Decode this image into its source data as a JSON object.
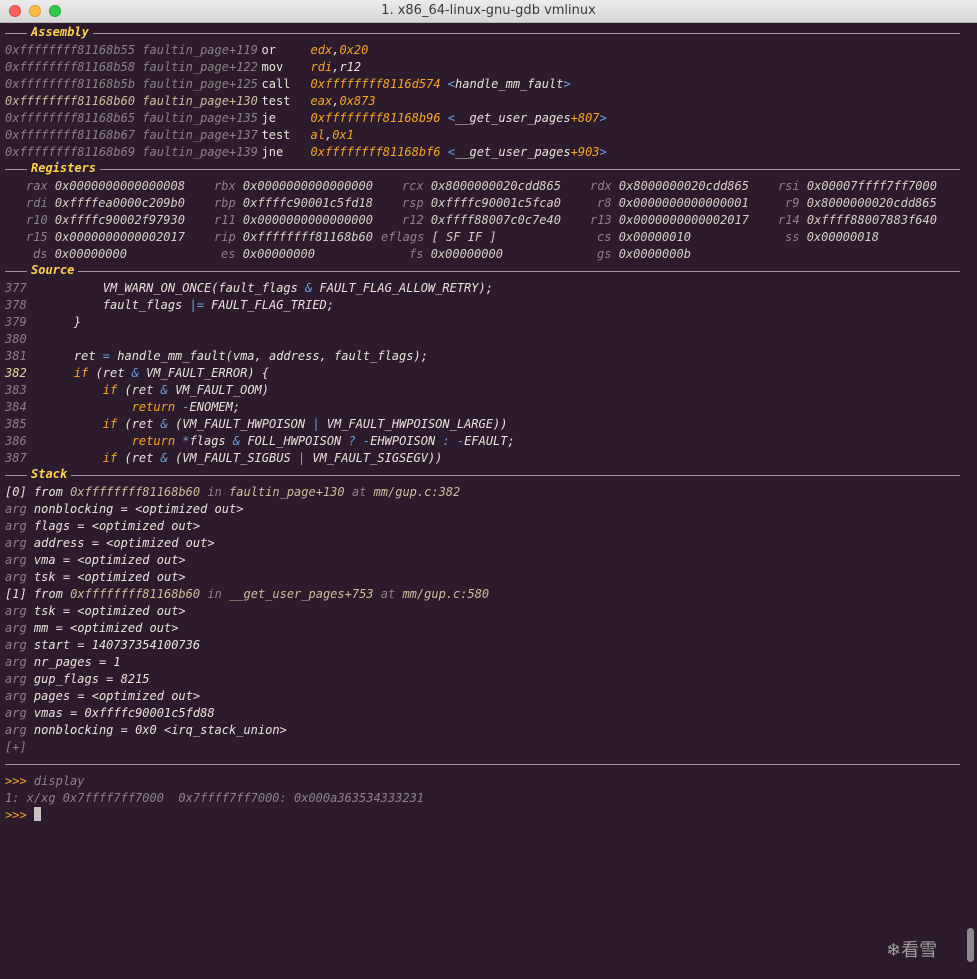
{
  "window": {
    "title": "1. x86_64-linux-gnu-gdb vmlinux"
  },
  "sections": {
    "assembly": "Assembly",
    "registers": "Registers",
    "source": "Source",
    "stack": "Stack"
  },
  "assembly": [
    {
      "addr": "0xffffffff81168b55",
      "sym": "faultin_page+119",
      "mnem": "or",
      "op1": "edx",
      "comma": ",",
      "op2": "0x20",
      "current": false
    },
    {
      "addr": "0xffffffff81168b58",
      "sym": "faultin_page+122",
      "mnem": "mov",
      "op1": "rdi",
      "comma": ",",
      "op2": "r12",
      "current": false
    },
    {
      "addr": "0xffffffff81168b5b",
      "sym": "faultin_page+125",
      "mnem": "call",
      "op1": "0xffffffff8116d574",
      "target": "handle_mm_fault",
      "current": false
    },
    {
      "addr": "0xffffffff81168b60",
      "sym": "faultin_page+130",
      "mnem": "test",
      "op1": "eax",
      "comma": ",",
      "op2": "0x873",
      "current": true
    },
    {
      "addr": "0xffffffff81168b65",
      "sym": "faultin_page+135",
      "mnem": "je",
      "op1": "0xffffffff81168b96",
      "target": "__get_user_pages",
      "offset": "+807",
      "current": false
    },
    {
      "addr": "0xffffffff81168b67",
      "sym": "faultin_page+137",
      "mnem": "test",
      "op1": "al",
      "comma": ",",
      "op2": "0x1",
      "current": false
    },
    {
      "addr": "0xffffffff81168b69",
      "sym": "faultin_page+139",
      "mnem": "jne",
      "op1": "0xffffffff81168bf6",
      "target": "__get_user_pages",
      "offset": "+903",
      "current": false
    }
  ],
  "registers": [
    [
      {
        "name": "rax",
        "value": "0x0000000000000008"
      },
      {
        "name": "rbx",
        "value": "0x0000000000000000"
      },
      {
        "name": "rcx",
        "value": "0x8000000020cdd865"
      },
      {
        "name": "rdx",
        "value": "0x8000000020cdd865"
      },
      {
        "name": "rsi",
        "value": "0x00007ffff7ff7000"
      }
    ],
    [
      {
        "name": "rdi",
        "value": "0xffffea0000c209b0"
      },
      {
        "name": "rbp",
        "value": "0xffffc90001c5fd18"
      },
      {
        "name": "rsp",
        "value": "0xffffc90001c5fca0"
      },
      {
        "name": "r8",
        "value": "0x0000000000000001"
      },
      {
        "name": "r9",
        "value": "0x8000000020cdd865"
      }
    ],
    [
      {
        "name": "r10",
        "value": "0xffffc90002f97930"
      },
      {
        "name": "r11",
        "value": "0x0000000000000000"
      },
      {
        "name": "r12",
        "value": "0xffff88007c0c7e40"
      },
      {
        "name": "r13",
        "value": "0x0000000000002017"
      },
      {
        "name": "r14",
        "value": "0xffff88007883f640"
      }
    ],
    [
      {
        "name": "r15",
        "value": "0x0000000000002017"
      },
      {
        "name": "rip",
        "value": "0xffffffff81168b60"
      },
      {
        "name": "eflags",
        "value": "[ SF IF ]"
      },
      {
        "name": "cs",
        "value": "0x00000010"
      },
      {
        "name": "ss",
        "value": "0x00000018"
      }
    ],
    [
      {
        "name": "ds",
        "value": "0x00000000"
      },
      {
        "name": "es",
        "value": "0x00000000"
      },
      {
        "name": "fs",
        "value": "0x00000000"
      },
      {
        "name": "gs",
        "value": "0x0000000b"
      }
    ]
  ],
  "source": [
    {
      "num": "377",
      "code": "        VM_WARN_ON_ONCE(fault_flags & FAULT_FLAG_ALLOW_RETRY);",
      "current": false
    },
    {
      "num": "378",
      "code": "        fault_flags |= FAULT_FLAG_TRIED;",
      "current": false
    },
    {
      "num": "379",
      "code": "    }",
      "current": false
    },
    {
      "num": "380",
      "code": "",
      "current": false
    },
    {
      "num": "381",
      "code": "    ret = handle_mm_fault(vma, address, fault_flags);",
      "current": false
    },
    {
      "num": "382",
      "code": "    if (ret & VM_FAULT_ERROR) {",
      "current": true
    },
    {
      "num": "383",
      "code": "        if (ret & VM_FAULT_OOM)",
      "current": false
    },
    {
      "num": "384",
      "code": "            return -ENOMEM;",
      "current": false
    },
    {
      "num": "385",
      "code": "        if (ret & (VM_FAULT_HWPOISON | VM_FAULT_HWPOISON_LARGE))",
      "current": false
    },
    {
      "num": "386",
      "code": "            return *flags & FOLL_HWPOISON ? -EHWPOISON : -EFAULT;",
      "current": false
    },
    {
      "num": "387",
      "code": "        if (ret & (VM_FAULT_SIGBUS | VM_FAULT_SIGSEGV))",
      "current": false
    }
  ],
  "stack": {
    "frames": [
      {
        "index": "[0]",
        "from": "from",
        "addr": "0xffffffff81168b60",
        "in": "in",
        "func": "faultin_page+130",
        "at": "at",
        "loc": "mm/gup.c:382",
        "args": [
          {
            "kw": "arg",
            "text": "nonblocking = <optimized out>"
          },
          {
            "kw": "arg",
            "text": "flags = <optimized out>"
          },
          {
            "kw": "arg",
            "text": "address = <optimized out>"
          },
          {
            "kw": "arg",
            "text": "vma = <optimized out>"
          },
          {
            "kw": "arg",
            "text": "tsk = <optimized out>"
          }
        ]
      },
      {
        "index": "[1]",
        "from": "from",
        "addr": "0xffffffff81168b60",
        "in": "in",
        "func": "__get_user_pages+753",
        "at": "at",
        "loc": "mm/gup.c:580",
        "args": [
          {
            "kw": "arg",
            "text": "tsk = <optimized out>"
          },
          {
            "kw": "arg",
            "text": "mm = <optimized out>"
          },
          {
            "kw": "arg",
            "text": "start = 140737354100736"
          },
          {
            "kw": "arg",
            "text": "nr_pages = 1"
          },
          {
            "kw": "arg",
            "text": "gup_flags = 8215"
          },
          {
            "kw": "arg",
            "text": "pages = <optimized out>"
          },
          {
            "kw": "arg",
            "text": "vmas = 0xffffc90001c5fd88"
          },
          {
            "kw": "arg",
            "text": "nonblocking = 0x0 <irq_stack_union>"
          }
        ]
      }
    ],
    "more": "[+]"
  },
  "console": {
    "prompt": ">>>",
    "command": "display",
    "output": "1: x/xg 0x7ffff7ff7000  0x7ffff7ff7000: 0x000a363534333231"
  },
  "watermark": "看雪"
}
